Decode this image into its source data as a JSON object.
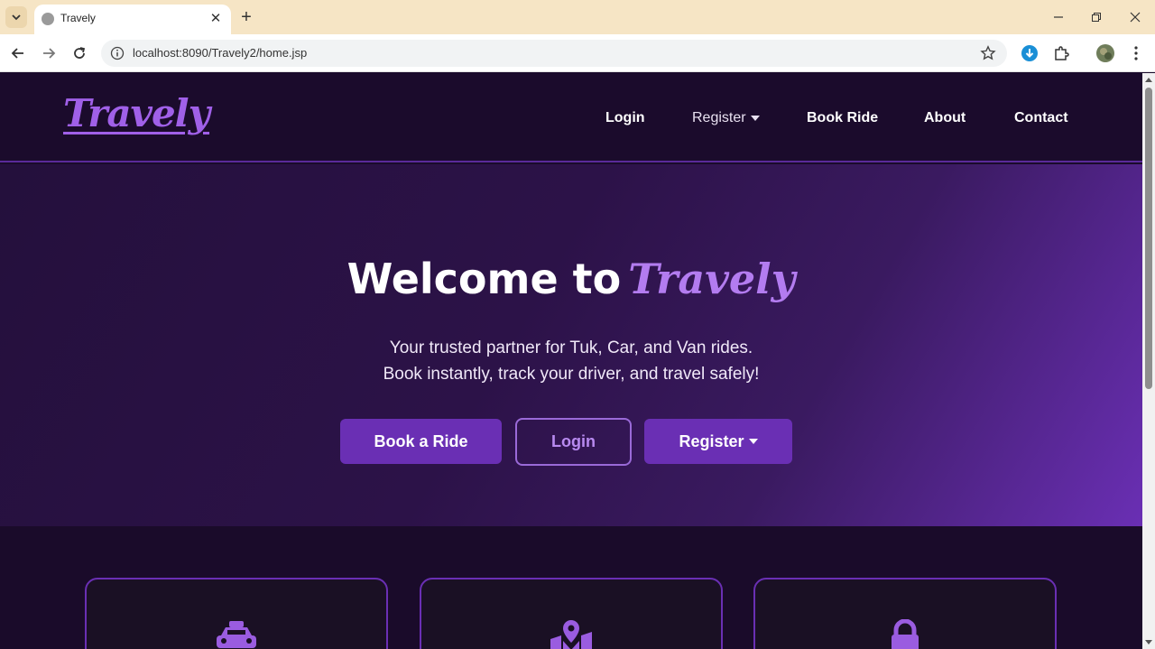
{
  "browser": {
    "tab_title": "Travely",
    "url": "localhost:8090/Travely2/home.jsp"
  },
  "site": {
    "logo": "Travely",
    "nav": {
      "login": "Login",
      "register": "Register",
      "book_ride": "Book Ride",
      "about": "About",
      "contact": "Contact"
    }
  },
  "hero": {
    "title_prefix": "Welcome to",
    "title_brand": "Travely",
    "subtitle_line1": "Your trusted partner for Tuk, Car, and Van rides.",
    "subtitle_line2": "Book instantly, track your driver, and travel safely!",
    "buttons": {
      "book": "Book a Ride",
      "login": "Login",
      "register": "Register"
    }
  },
  "features": {
    "cards": [
      {
        "icon": "taxi-icon"
      },
      {
        "icon": "map-location-icon"
      },
      {
        "icon": "lock-icon"
      }
    ]
  },
  "colors": {
    "accent": "#6a2fb4",
    "brand_text": "#b37cf0",
    "nav_bg": "#1b0b2c"
  }
}
